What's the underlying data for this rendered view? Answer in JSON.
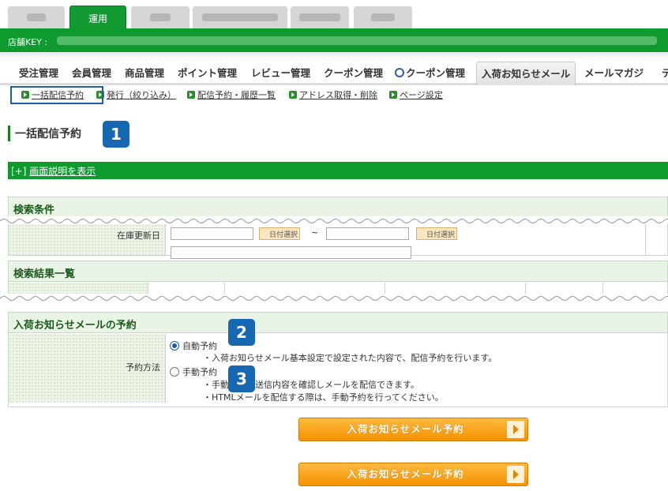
{
  "top_tabs": {
    "active_label": "運用"
  },
  "shop_bar": {
    "label": "店舗KEY :"
  },
  "main_nav": {
    "items": [
      {
        "label": "受注管理"
      },
      {
        "label": "会員管理"
      },
      {
        "label": "商品管理"
      },
      {
        "label": "ポイント管理"
      },
      {
        "label": "レビュー管理"
      },
      {
        "label": "クーポン管理"
      },
      {
        "label": "クーポン管理"
      },
      {
        "label": "入荷お知らせメール"
      },
      {
        "label": "メールマガジ"
      },
      {
        "label": "テ"
      }
    ]
  },
  "sub_nav": {
    "items": [
      {
        "label": "一括配信予約"
      },
      {
        "label": "発行（絞り込み）"
      },
      {
        "label": "配信予約・履歴一覧"
      },
      {
        "label": "アドレス取得・削除"
      },
      {
        "label": "ページ設定"
      }
    ]
  },
  "page": {
    "title": "一括配信予約"
  },
  "badges": [
    "1",
    "2",
    "3"
  ],
  "help_bar": {
    "prefix": "[+]",
    "link": "画面説明を表示"
  },
  "search_conditions": {
    "heading": "検索条件",
    "row_label": "在庫更新日",
    "cal_button": "日付選択",
    "range_sep": "~"
  },
  "search_results": {
    "heading": "検索結果一覧"
  },
  "reservation": {
    "heading": "入荷お知らせメールの予約",
    "field_label": "予約方法",
    "options": [
      {
        "label": "自動予約",
        "selected": true,
        "notes": [
          "・入荷お知らせメール基本設定で設定された内容で、配信予約を行います。"
        ]
      },
      {
        "label": "手動予約",
        "selected": false,
        "notes": [
          "・手動予約は送信内容を確認しメールを配信できます。",
          "・HTMLメールを配信する際は、手動予約を行ってください。"
        ]
      }
    ]
  },
  "buttons": {
    "submit_label": "入荷お知らせメール予約"
  },
  "colors": {
    "brand_green": "#0f9a30",
    "badge_blue": "#1768b3",
    "button_orange": "#f39300"
  }
}
